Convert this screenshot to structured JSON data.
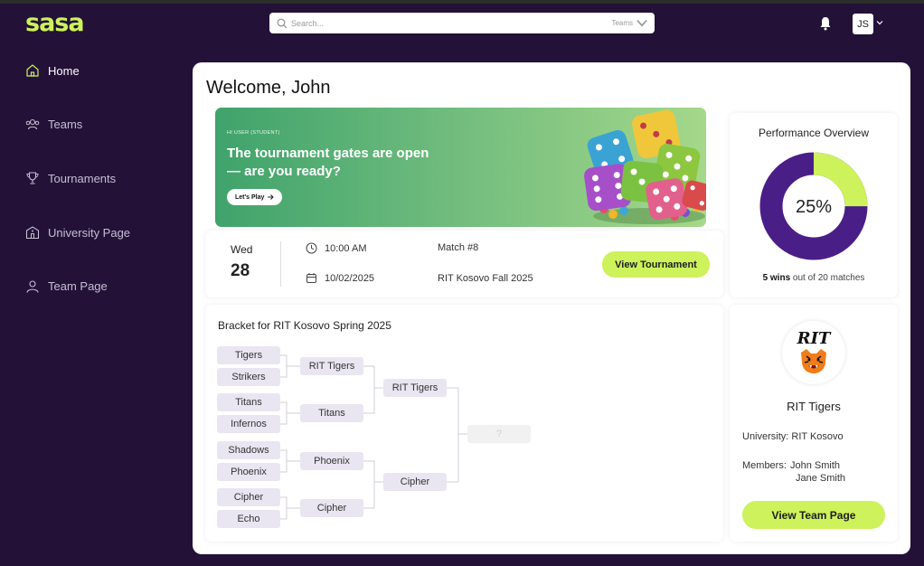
{
  "brand": {
    "logo": "sasa",
    "accent": "#cdf25b",
    "bg": "#231138"
  },
  "search": {
    "placeholder": "Search...",
    "scope": "Teams"
  },
  "user": {
    "initials": "JS"
  },
  "sidebar": {
    "items": [
      {
        "label": "Home",
        "icon": "home-icon",
        "active": true
      },
      {
        "label": "Teams",
        "icon": "users-icon",
        "active": false
      },
      {
        "label": "Tournaments",
        "icon": "trophy-icon",
        "active": false
      },
      {
        "label": "University Page",
        "icon": "building-icon",
        "active": false
      },
      {
        "label": "Team Page",
        "icon": "user-icon",
        "active": false
      }
    ]
  },
  "main": {
    "welcome": "Welcome, John",
    "banner": {
      "kicker": "HI USER (STUDENT)",
      "headline": "The tournament gates are open — are you ready?",
      "cta": "Let's Play"
    },
    "match": {
      "day": "Wed",
      "date": "28",
      "time": "10:00 AM",
      "full_date": "10/02/2025",
      "match_no": "Match #8",
      "tournament": "RIT Kosovo Fall 2025",
      "cta": "View Tournament"
    },
    "performance": {
      "title": "Performance Overview",
      "percent_label": "25%",
      "win_fraction": 0.25,
      "wins": "5 wins",
      "rest": "out of 20 matches",
      "colors": {
        "wins": "#cdf25b",
        "losses": "#4a1e87"
      }
    },
    "bracket": {
      "title": "Bracket for RIT Kosovo Spring 2025",
      "round1": [
        "Tigers",
        "Strikers",
        "Titans",
        "Infernos",
        "Shadows",
        "Phoenix",
        "Cipher",
        "Echo"
      ],
      "round2": [
        "RIT Tigers",
        "Titans",
        "Phoenix",
        "Cipher"
      ],
      "round3": [
        "RIT Tigers",
        "Cipher"
      ],
      "final": "?"
    },
    "team": {
      "logo_text": "RIT",
      "name": "RIT Tigers",
      "university": "University: RIT Kosovo",
      "members_label": "Members:",
      "members": [
        "John Smith",
        "Jane Smith"
      ],
      "cta": "View Team Page"
    }
  }
}
